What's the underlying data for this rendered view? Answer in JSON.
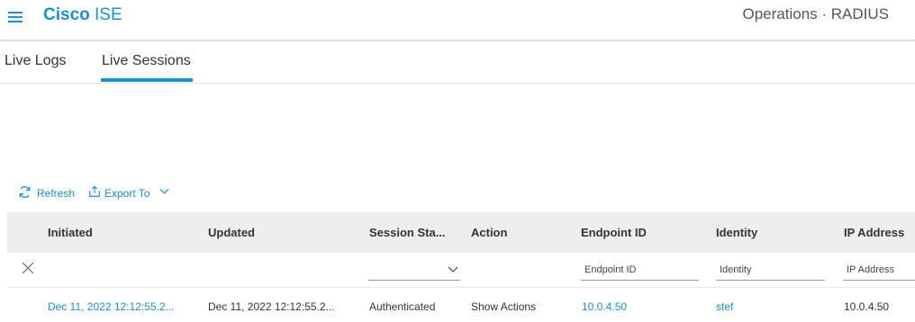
{
  "header": {
    "brand_bold": "Cisco",
    "brand_rest": "ISE",
    "context": "Operations · RADIUS",
    "accent_color": "#1e8fc7"
  },
  "tabs": [
    {
      "label": "Live Logs",
      "active": false
    },
    {
      "label": "Live Sessions",
      "active": true
    }
  ],
  "toolbar": {
    "refresh_label": "Refresh",
    "refresh_icon": "refresh-icon",
    "export_label": "Export To",
    "export_icon": "export-icon"
  },
  "table": {
    "columns": [
      "Initiated",
      "Updated",
      "Session Sta...",
      "Action",
      "Endpoint ID",
      "Identity",
      "IP Address"
    ],
    "filters": {
      "session_status_selected": "",
      "endpoint_id_placeholder": "Endpoint ID",
      "identity_placeholder": "Identity",
      "ip_address_placeholder": "IP Address"
    },
    "rows": [
      {
        "initiated": "Dec 11, 2022 12:12:55.2...",
        "updated": "Dec 11, 2022 12:12:55.2...",
        "session_status": "Authenticated",
        "action": "Show Actions",
        "endpoint_id": "10.0.4.50",
        "identity": "stef",
        "ip_address": "10.0.4.50"
      }
    ]
  }
}
